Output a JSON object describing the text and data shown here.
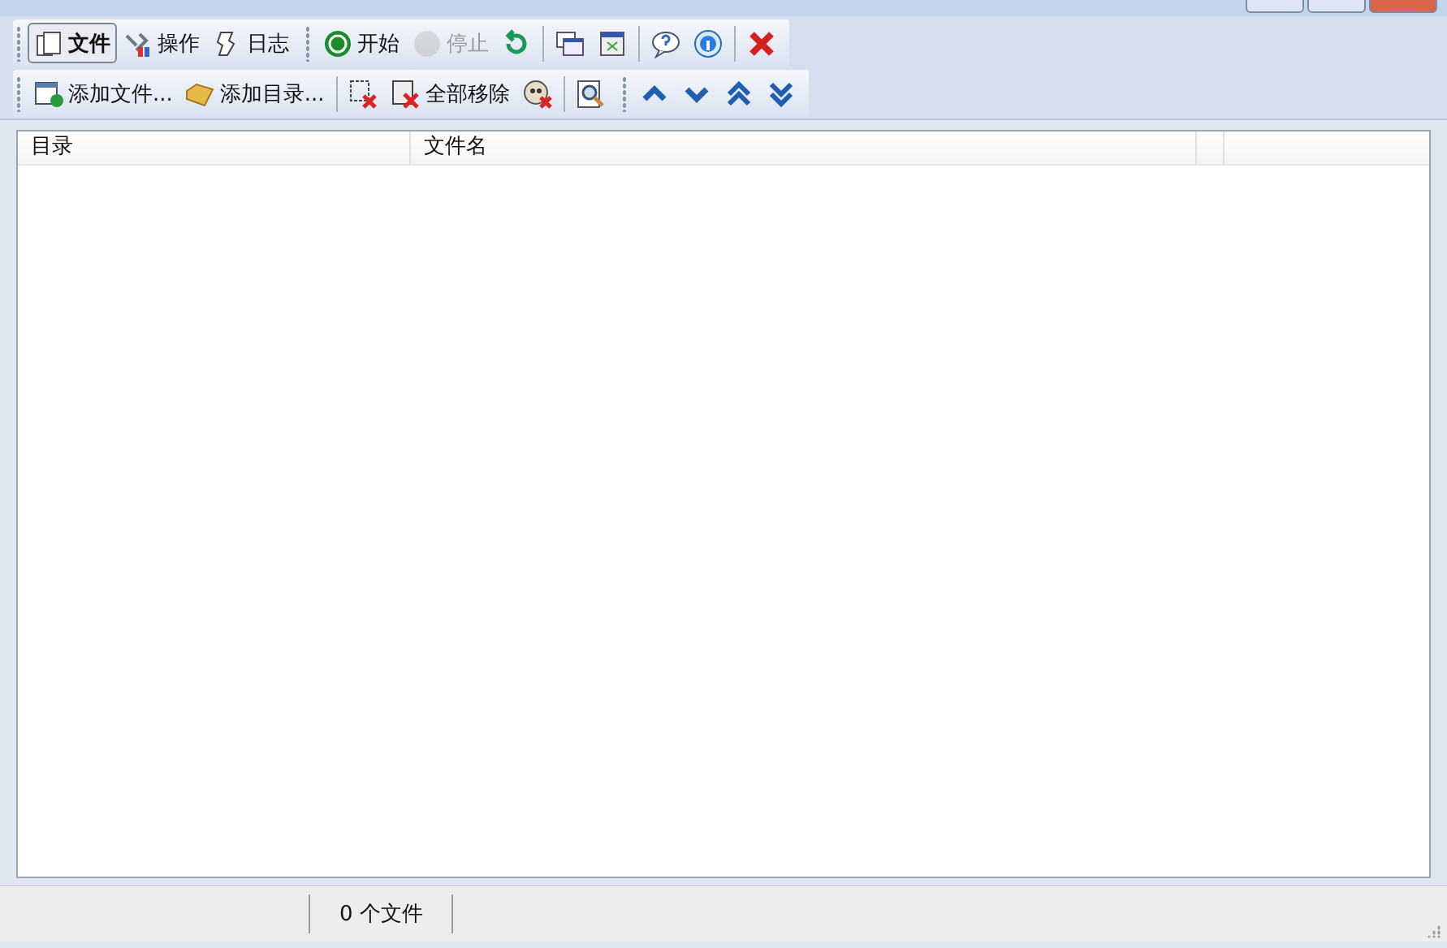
{
  "toolbar_top": [
    {
      "kind": "tab",
      "label": "文件",
      "selected": true
    },
    {
      "kind": "tab",
      "label": "操作",
      "selected": false
    },
    {
      "kind": "tab",
      "label": "日志",
      "selected": false
    },
    {
      "kind": "grip"
    },
    {
      "kind": "button",
      "label": "开始",
      "disabled": false
    },
    {
      "kind": "button",
      "label": "停止",
      "disabled": true
    },
    {
      "kind": "button",
      "disabled": false
    },
    {
      "kind": "separator"
    },
    {
      "kind": "button",
      "disabled": false
    },
    {
      "kind": "button",
      "disabled": false
    },
    {
      "kind": "separator"
    },
    {
      "kind": "button",
      "disabled": false
    },
    {
      "kind": "button",
      "disabled": false
    },
    {
      "kind": "separator"
    },
    {
      "kind": "button",
      "disabled": false
    }
  ],
  "toolbar_bottom": [
    {
      "kind": "button",
      "label": "添加文件...",
      "disabled": false
    },
    {
      "kind": "button",
      "label": "添加目录...",
      "disabled": false
    },
    {
      "kind": "separator"
    },
    {
      "kind": "button",
      "disabled": false
    },
    {
      "kind": "button",
      "label": "全部移除",
      "disabled": false
    },
    {
      "kind": "button",
      "disabled": false
    },
    {
      "kind": "separator"
    },
    {
      "kind": "button",
      "disabled": false
    },
    {
      "kind": "grip"
    },
    {
      "kind": "button",
      "disabled": false
    },
    {
      "kind": "button",
      "disabled": false
    },
    {
      "kind": "button",
      "disabled": false
    },
    {
      "kind": "button",
      "disabled": false
    }
  ],
  "table": {
    "columns": [
      "目录",
      "文件名"
    ]
  },
  "status_bar": {
    "file_count": "0 个文件"
  }
}
